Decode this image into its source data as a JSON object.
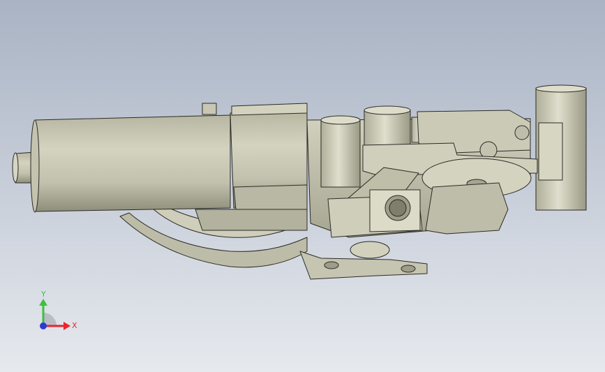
{
  "viewport": {
    "background_top": "#a9b3c4",
    "background_bottom": "#e6e9ee",
    "model_fill": "#c9c8b4",
    "model_shade": "#a8a792",
    "model_dark": "#7f7e6b",
    "edge_color": "#2b2b26"
  },
  "triad": {
    "x_label": "X",
    "y_label": "Y",
    "x_color": "#e8262b",
    "y_color": "#3fbf3f",
    "z_color": "#2a3bd6"
  }
}
